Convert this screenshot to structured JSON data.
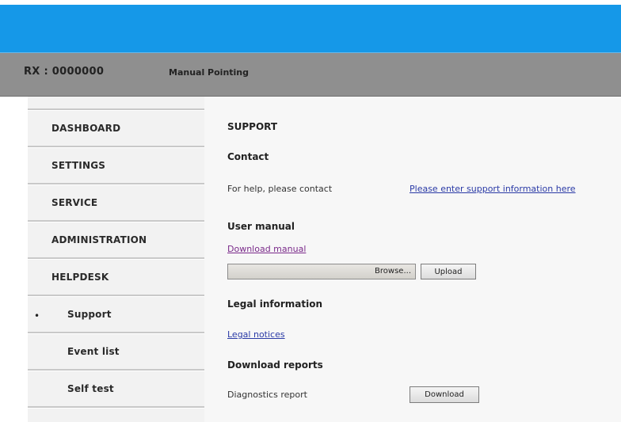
{
  "header": {
    "rx_label": "RX : 0000000",
    "mode": "Manual Pointing"
  },
  "sidebar": {
    "items": [
      {
        "label": "DASHBOARD"
      },
      {
        "label": "SETTINGS"
      },
      {
        "label": "SERVICE"
      },
      {
        "label": "ADMINISTRATION"
      },
      {
        "label": "HELPDESK"
      },
      {
        "label": "Support",
        "bullet": "•"
      },
      {
        "label": "Event list"
      },
      {
        "label": "Self test"
      }
    ]
  },
  "main": {
    "page_title": "SUPPORT",
    "contact": {
      "title": "Contact",
      "text": "For help, please contact",
      "link": "Please enter support information here"
    },
    "user_manual": {
      "title": "User manual",
      "download_link": "Download manual",
      "browse_label": "Browse...",
      "upload_label": "Upload"
    },
    "legal": {
      "title": "Legal information",
      "link": "Legal notices"
    },
    "reports": {
      "title": "Download reports",
      "item_label": "Diagnostics report",
      "download_label": "Download"
    }
  },
  "colors": {
    "banner": "#1598e8",
    "status_bar": "#8f8f8f",
    "link": "#2a3aa6",
    "visited_link": "#7a2a8a"
  }
}
